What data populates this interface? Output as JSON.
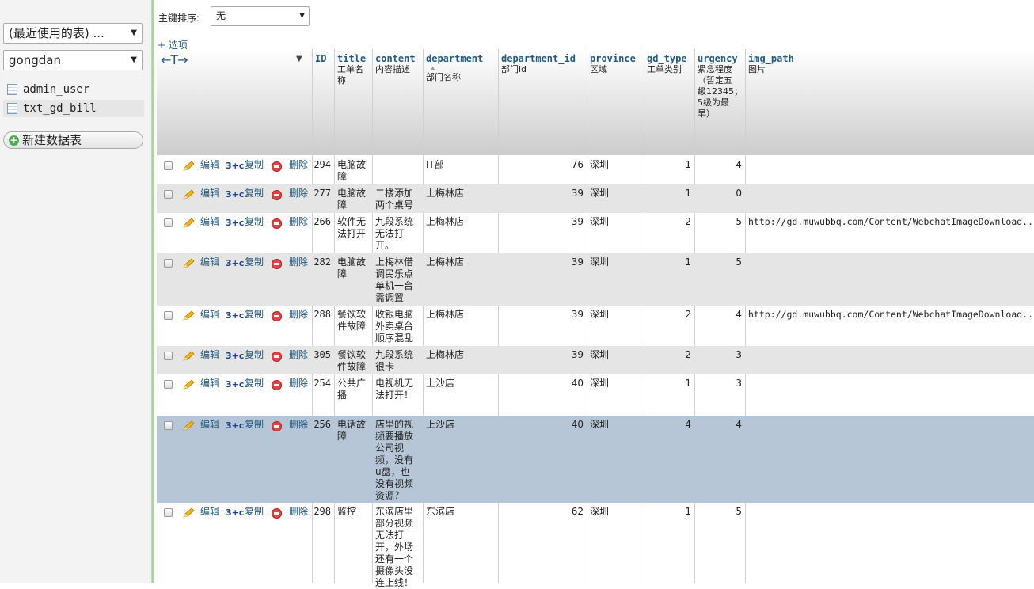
{
  "sidebar": {
    "recent_select": "(最近使用的表) ...",
    "db_select": "gongdan",
    "tables": [
      "admin_user",
      "txt_gd_bill"
    ],
    "new_table": "新建数据表"
  },
  "toolbar": {
    "sort_label": "主键排序:",
    "sort_value": "无",
    "options_link": "+ 选项",
    "arrows": "←T→"
  },
  "columns": [
    {
      "name": "ID",
      "comment": ""
    },
    {
      "name": "title",
      "comment": "工单名称"
    },
    {
      "name": "content",
      "comment": "内容描述"
    },
    {
      "name": "department",
      "comment": "部门名称"
    },
    {
      "name": "department_id",
      "comment": "部门id"
    },
    {
      "name": "province",
      "comment": "区域"
    },
    {
      "name": "gd_type",
      "comment": "工单类别"
    },
    {
      "name": "urgency",
      "comment": "紧急程度（暂定五级12345；5级为最早）"
    },
    {
      "name": "img_path",
      "comment": "图片"
    }
  ],
  "sort_marker": "▲",
  "actions": {
    "edit": "编辑",
    "copy": "复制",
    "delete": "删除"
  },
  "rows": [
    {
      "id": "294",
      "title": "电脑故障",
      "content": "",
      "department": "IT部",
      "department_id": "76",
      "province": "深圳",
      "gd_type": "1",
      "urgency": "4",
      "img_path": ""
    },
    {
      "id": "277",
      "title": "电脑故障",
      "content": "二楼添加两个桌号",
      "department": "上梅林店",
      "department_id": "39",
      "province": "深圳",
      "gd_type": "1",
      "urgency": "0",
      "img_path": ""
    },
    {
      "id": "266",
      "title": "软件无法打开",
      "content": "九段系统无法打开。",
      "department": "上梅林店",
      "department_id": "39",
      "province": "深圳",
      "gd_type": "2",
      "urgency": "5",
      "img_path": "http://gd.muwubbq.com/Content/WebchatImageDownload..."
    },
    {
      "id": "282",
      "title": "电脑故障",
      "content": "上梅林借调民乐点单机一台需调置",
      "department": "上梅林店",
      "department_id": "39",
      "province": "深圳",
      "gd_type": "1",
      "urgency": "5",
      "img_path": ""
    },
    {
      "id": "288",
      "title": "餐饮软件故障",
      "content": "收银电脑外卖桌台顺序混乱",
      "department": "上梅林店",
      "department_id": "39",
      "province": "深圳",
      "gd_type": "2",
      "urgency": "4",
      "img_path": "http://gd.muwubbq.com/Content/WebchatImageDownload..."
    },
    {
      "id": "305",
      "title": "餐饮软件故障",
      "content": "九段系统很卡",
      "department": "上梅林店",
      "department_id": "39",
      "province": "深圳",
      "gd_type": "2",
      "urgency": "3",
      "img_path": ""
    },
    {
      "id": "254",
      "title": "公共广播",
      "content": "电视机无法打开！",
      "department": "上沙店",
      "department_id": "40",
      "province": "深圳",
      "gd_type": "1",
      "urgency": "3",
      "img_path": ""
    },
    {
      "id": "256",
      "title": "电话故障",
      "content": "店里的视频要播放公司视频，没有u盘，也没有视频资源？",
      "department": "上沙店",
      "department_id": "40",
      "province": "深圳",
      "gd_type": "4",
      "urgency": "4",
      "img_path": ""
    },
    {
      "id": "298",
      "title": "监控",
      "content": "东滨店里部分视频无法打开，外场还有一个摄像头没连上线！",
      "department": "东滨店",
      "department_id": "62",
      "province": "深圳",
      "gd_type": "1",
      "urgency": "5",
      "img_path": ""
    }
  ]
}
